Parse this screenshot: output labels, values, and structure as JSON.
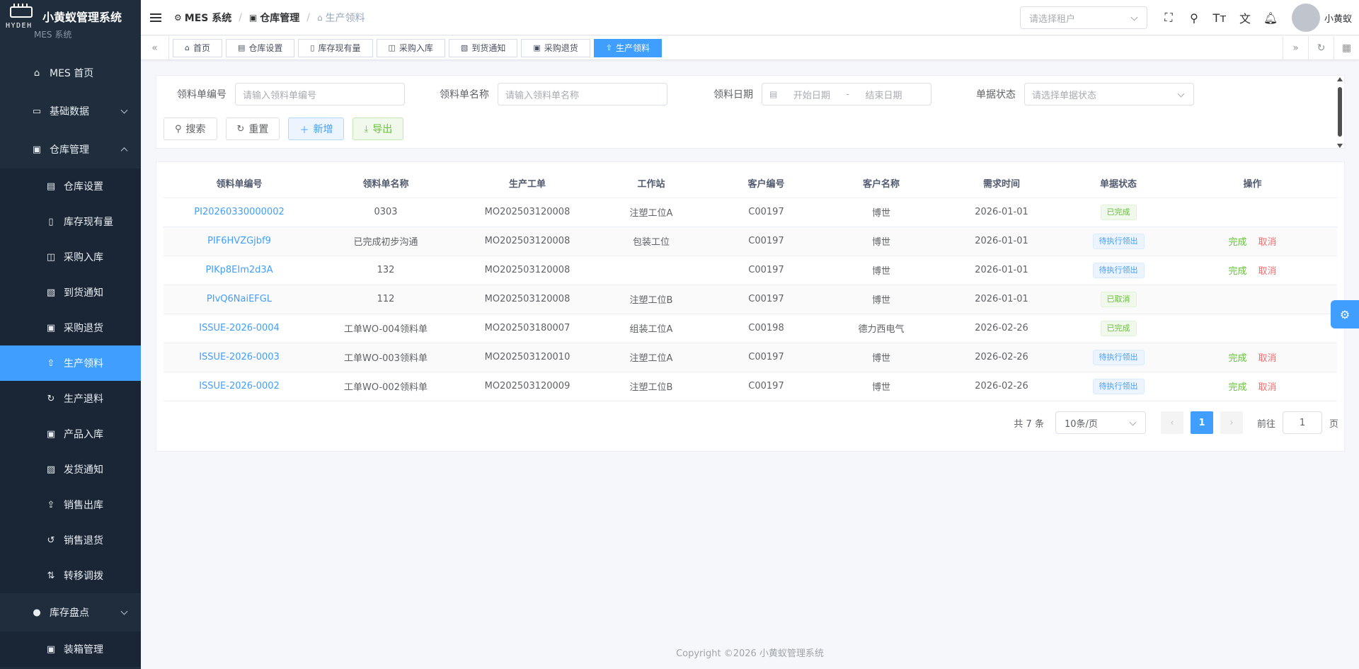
{
  "app": {
    "title": "小黄蚁管理系统",
    "subtitle": "MES 系统",
    "brand_text": "HYDEH"
  },
  "sidebar": {
    "items": [
      {
        "label": "MES 首页",
        "icon": "home-icon",
        "level": 1
      },
      {
        "label": "基础数据",
        "icon": "monitor-icon",
        "level": 1,
        "caret": "down"
      },
      {
        "label": "仓库管理",
        "icon": "warehouse-icon",
        "level": 1,
        "caret": "up"
      },
      {
        "label": "仓库设置",
        "icon": "building-icon",
        "level": 2
      },
      {
        "label": "库存现有量",
        "icon": "document-icon",
        "level": 2
      },
      {
        "label": "采购入库",
        "icon": "bag-icon",
        "level": 2
      },
      {
        "label": "到货通知",
        "icon": "document-check-icon",
        "level": 2
      },
      {
        "label": "采购退货",
        "icon": "box-icon",
        "level": 2
      },
      {
        "label": "生产领料",
        "icon": "pick-icon",
        "level": 2,
        "active": true
      },
      {
        "label": "生产退料",
        "icon": "refresh-icon",
        "level": 2
      },
      {
        "label": "产品入库",
        "icon": "box-in-icon",
        "level": 2
      },
      {
        "label": "发货通知",
        "icon": "notice-icon",
        "level": 2
      },
      {
        "label": "销售出库",
        "icon": "outbound-icon",
        "level": 2
      },
      {
        "label": "销售退货",
        "icon": "return-icon",
        "level": 2
      },
      {
        "label": "转移调拨",
        "icon": "transfer-icon",
        "level": 2
      },
      {
        "label": "库存盘点",
        "icon": "check-circle-icon",
        "level": 1,
        "caret": "down"
      },
      {
        "label": "装箱管理",
        "icon": "package-icon",
        "level": 2
      }
    ]
  },
  "header": {
    "breadcrumb": [
      "MES 系统",
      "仓库管理",
      "生产领料"
    ],
    "tenant_placeholder": "请选择租户",
    "username": "小黄蚁"
  },
  "tags": [
    {
      "label": "首页",
      "icon": "home-icon"
    },
    {
      "label": "仓库设置",
      "icon": "building-icon"
    },
    {
      "label": "库存现有量",
      "icon": "document-icon"
    },
    {
      "label": "采购入库",
      "icon": "bag-icon"
    },
    {
      "label": "到货通知",
      "icon": "document-check-icon"
    },
    {
      "label": "采购退货",
      "icon": "box-icon"
    },
    {
      "label": "生产领料",
      "icon": "pick-icon",
      "active": true
    }
  ],
  "search": {
    "code_label": "领料单编号",
    "code_placeholder": "请输入领料单编号",
    "name_label": "领料单名称",
    "name_placeholder": "请输入领料单名称",
    "date_label": "领料日期",
    "date_start": "开始日期",
    "date_sep": "-",
    "date_end": "结束日期",
    "status_label": "单据状态",
    "status_placeholder": "请选择单据状态",
    "buttons": {
      "search": "搜索",
      "reset": "重置",
      "add": "新增",
      "export": "导出"
    }
  },
  "table": {
    "columns": [
      "领料单编号",
      "领料单名称",
      "生产工单",
      "工作站",
      "客户编号",
      "客户名称",
      "需求时间",
      "单据状态",
      "操作"
    ],
    "rows": [
      {
        "code": "PI20260330000002",
        "name": "0303",
        "order": "MO202503120008",
        "station": "注塑工位A",
        "cust_code": "C00197",
        "cust_name": "博世",
        "date": "2026-01-01",
        "status": "已完成",
        "status_type": "done",
        "ops": []
      },
      {
        "code": "PIF6HVZGjbf9",
        "name": "已完成初步沟通",
        "order": "MO202503120008",
        "station": "包装工位",
        "cust_code": "C00197",
        "cust_name": "博世",
        "date": "2026-01-01",
        "status": "待执行领出",
        "status_type": "wait",
        "ops": [
          "完成",
          "取消"
        ]
      },
      {
        "code": "PIKp8EIm2d3A",
        "name": "132",
        "order": "MO202503120008",
        "station": "",
        "cust_code": "C00197",
        "cust_name": "博世",
        "date": "2026-01-01",
        "status": "待执行领出",
        "status_type": "wait",
        "ops": [
          "完成",
          "取消"
        ]
      },
      {
        "code": "PIvQ6NaiEFGL",
        "name": "112",
        "order": "MO202503120008",
        "station": "注塑工位B",
        "cust_code": "C00197",
        "cust_name": "博世",
        "date": "2026-01-01",
        "status": "已取消",
        "status_type": "done",
        "ops": []
      },
      {
        "code": "ISSUE-2026-0004",
        "name": "工单WO-004领料单",
        "order": "MO202503180007",
        "station": "组装工位A",
        "cust_code": "C00198",
        "cust_name": "德力西电气",
        "date": "2026-02-26",
        "status": "已完成",
        "status_type": "done",
        "ops": []
      },
      {
        "code": "ISSUE-2026-0003",
        "name": "工单WO-003领料单",
        "order": "MO202503120010",
        "station": "注塑工位A",
        "cust_code": "C00197",
        "cust_name": "博世",
        "date": "2026-02-26",
        "status": "待执行领出",
        "status_type": "wait",
        "ops": [
          "完成",
          "取消"
        ]
      },
      {
        "code": "ISSUE-2026-0002",
        "name": "工单WO-002领料单",
        "order": "MO202503120009",
        "station": "注塑工位B",
        "cust_code": "C00197",
        "cust_name": "博世",
        "date": "2026-02-26",
        "status": "待执行领出",
        "status_type": "wait",
        "ops": [
          "完成",
          "取消"
        ]
      }
    ]
  },
  "pagination": {
    "total": "共 7 条",
    "page_size": "10条/页",
    "current_page": "1",
    "goto_label": "前往",
    "goto_value": "1",
    "page_suffix": "页"
  },
  "footer": {
    "copyright": "Copyright ©2026 小黄蚁管理系统"
  },
  "colors": {
    "sidebar_bg": "#1f2d3d",
    "primary": "#409eff",
    "success": "#67c23a",
    "danger": "#f56c6c"
  }
}
